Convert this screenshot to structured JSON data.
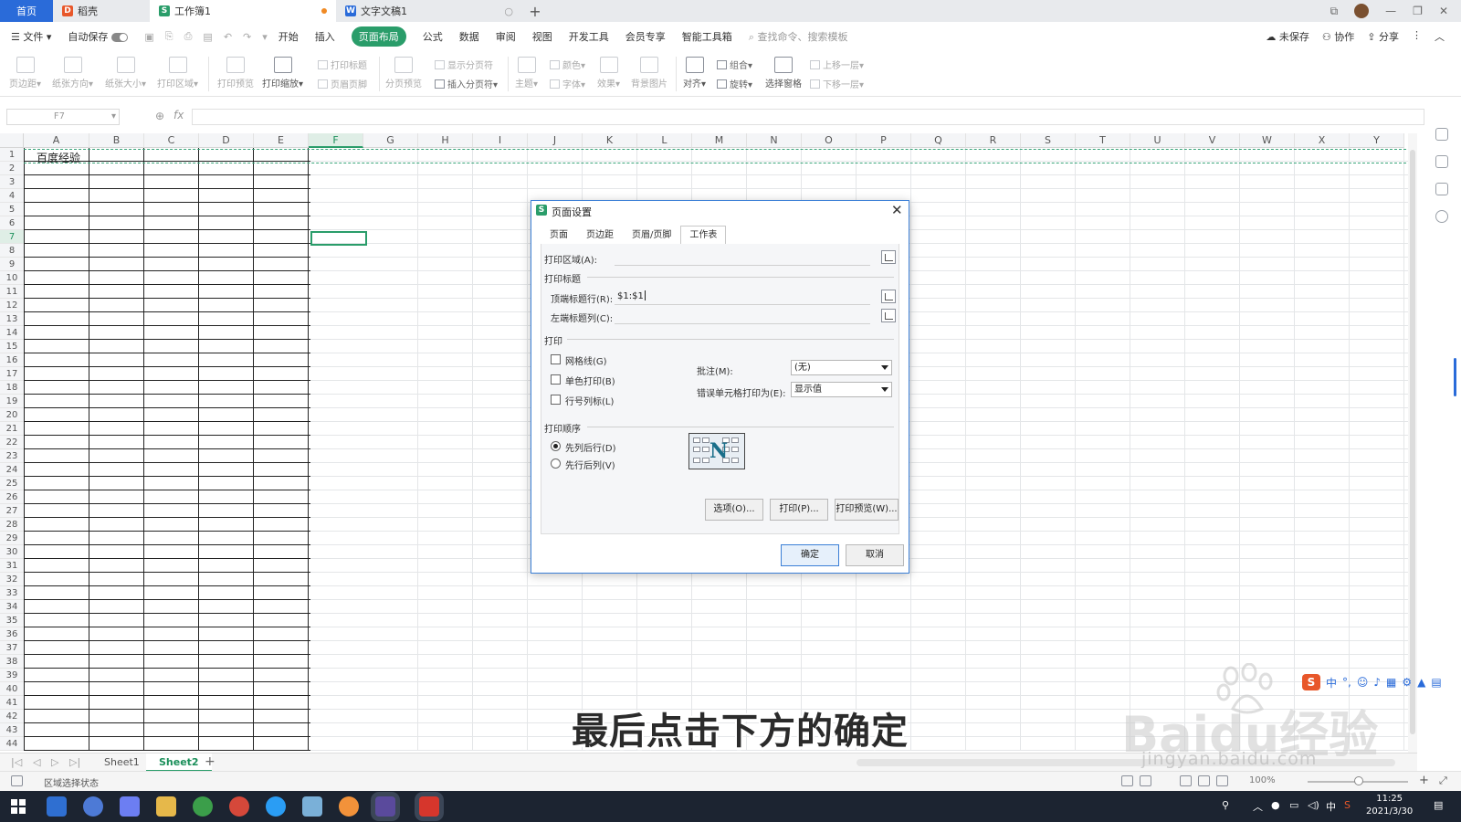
{
  "tabs": {
    "home": "首页",
    "doc1": "稻壳",
    "workbook": "工作簿1",
    "textdoc": "文字文稿1"
  },
  "menubar": {
    "file": "文件",
    "autosave": "自动保存",
    "items": [
      "开始",
      "插入",
      "页面布局",
      "公式",
      "数据",
      "审阅",
      "视图",
      "开发工具",
      "会员专享",
      "智能工具箱"
    ],
    "search": "查找命令、搜索模板",
    "unsaved": "未保存",
    "collab": "协作",
    "share": "分享"
  },
  "ribbon": {
    "margins": "页边距",
    "orientation": "纸张方向",
    "size": "纸张大小",
    "print_area": "打印区域",
    "print_preview": "打印预览",
    "print_scale": "打印缩放",
    "print_titles": "打印标题",
    "header_footer": "页眉页脚",
    "page_break_preview": "分页预览",
    "show_page_break": "显示分页符",
    "insert_page_break": "插入分页符",
    "theme": "主题",
    "color": "颜色",
    "font": "字体",
    "effect": "效果",
    "bg_image": "背景图片",
    "align": "对齐",
    "group": "组合",
    "rotate": "旋转",
    "selection_pane": "选择窗格",
    "bring_forward": "上移一层",
    "send_backward": "下移一层"
  },
  "formula_bar": {
    "namebox": "F7",
    "fx": "fx",
    "value": ""
  },
  "sheet": {
    "columns": [
      "A",
      "B",
      "C",
      "D",
      "E",
      "F",
      "G",
      "H",
      "I",
      "J",
      "K",
      "L",
      "M",
      "N",
      "O",
      "P",
      "Q",
      "R",
      "S",
      "T",
      "U",
      "V",
      "W",
      "X",
      "Y"
    ],
    "row_count": 44,
    "selected_column": "F",
    "selected_row": 7,
    "cell_A1": "百度经验"
  },
  "sheet_tabs": [
    "Sheet1",
    "Sheet2"
  ],
  "active_sheet": "Sheet2",
  "status": {
    "text": "区域选择状态",
    "zoom": "100%"
  },
  "dialog": {
    "title": "页面设置",
    "tabs": [
      "页面",
      "页边距",
      "页眉/页脚",
      "工作表"
    ],
    "active_tab": "工作表",
    "print_area_label": "打印区域(A):",
    "print_area_value": "",
    "print_titles_group": "打印标题",
    "top_rows_label": "顶端标题行(R):",
    "top_rows_value": "$1:$1",
    "left_cols_label": "左端标题列(C):",
    "left_cols_value": "",
    "print_group": "打印",
    "gridlines": "网格线(G)",
    "mono": "单色打印(B)",
    "row_col_headers": "行号列标(L)",
    "comments_label": "批注(M):",
    "comments_value": "(无)",
    "errors_label": "错误单元格打印为(E):",
    "errors_value": "显示值",
    "order_group": "打印顺序",
    "down_then_over": "先列后行(D)",
    "over_then_down": "先行后列(V)",
    "options_btn": "选项(O)...",
    "print_btn": "打印(P)...",
    "preview_btn": "打印预览(W)...",
    "ok_btn": "确定",
    "cancel_btn": "取消"
  },
  "taskbar": {
    "ime_lang": "中",
    "time": "11:25",
    "date": "2021/3/30"
  },
  "overlay": {
    "caption": "最后点击下方的确定",
    "watermark": "Baidu经验",
    "watermark_url": "jingyan.baidu.com"
  },
  "colors": {
    "accent_green": "#2a9d6a",
    "tab_blue": "#2a6bd9",
    "taskbar_bg": "#1c2431"
  }
}
